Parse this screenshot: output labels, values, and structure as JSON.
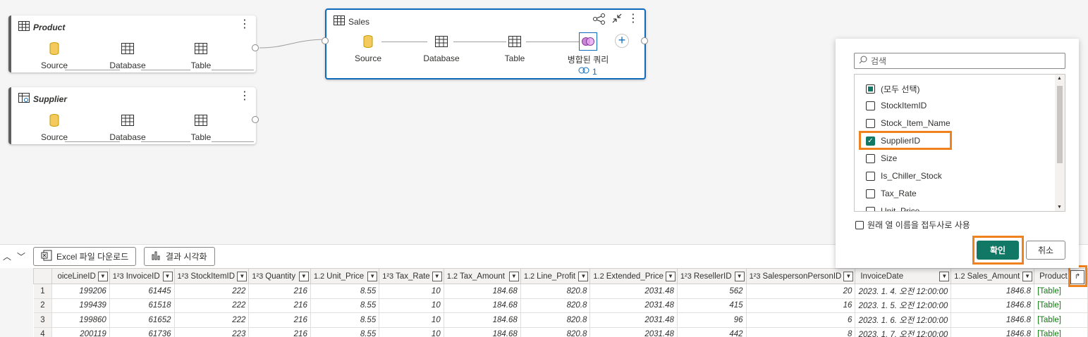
{
  "queries": {
    "product": {
      "title": "Product",
      "steps": [
        "Source",
        "Database",
        "Table"
      ]
    },
    "supplier": {
      "title": "Supplier",
      "steps": [
        "Source",
        "Database",
        "Table"
      ]
    },
    "sales": {
      "title": "Sales",
      "steps": [
        "Source",
        "Database",
        "Table",
        "병합된 쿼리"
      ],
      "link_count": "1"
    }
  },
  "toolbar": {
    "excel_label": "Excel 파일 다운로드",
    "visualize_label": "결과 시각화"
  },
  "filter_panel": {
    "search_placeholder": "검색",
    "items": [
      {
        "label": "(모두 선택)",
        "state": "indeterminate"
      },
      {
        "label": "StockItemID",
        "state": "unchecked"
      },
      {
        "label": "Stock_Item_Name",
        "state": "unchecked"
      },
      {
        "label": "SupplierID",
        "state": "checked"
      },
      {
        "label": "Size",
        "state": "unchecked"
      },
      {
        "label": "Is_Chiller_Stock",
        "state": "unchecked"
      },
      {
        "label": "Tax_Rate",
        "state": "unchecked"
      },
      {
        "label": "Unit_Price",
        "state": "unchecked"
      }
    ],
    "prefix_label": "원래 열 이름을 접두사로 사용",
    "ok_label": "확인",
    "cancel_label": "취소"
  },
  "grid": {
    "columns": [
      {
        "type": "",
        "name": "oiceLineID"
      },
      {
        "type": "1²3",
        "name": "InvoiceID"
      },
      {
        "type": "1²3",
        "name": "StockItemID"
      },
      {
        "type": "1²3",
        "name": "Quantity"
      },
      {
        "type": "1.2",
        "name": "Unit_Price"
      },
      {
        "type": "1²3",
        "name": "Tax_Rate"
      },
      {
        "type": "1.2",
        "name": "Tax_Amount"
      },
      {
        "type": "1.2",
        "name": "Line_Profit"
      },
      {
        "type": "1.2",
        "name": "Extended_Price"
      },
      {
        "type": "1²3",
        "name": "ResellerID"
      },
      {
        "type": "1²3",
        "name": "SalespersonPersonID"
      },
      {
        "type": "",
        "name": "InvoiceDate"
      },
      {
        "type": "1.2",
        "name": "Sales_Amount"
      },
      {
        "type": "",
        "name": "Product"
      }
    ],
    "rows": [
      [
        "1",
        "199206",
        "61445",
        "222",
        "216",
        "8.55",
        "10",
        "184.68",
        "820.8",
        "2031.48",
        "562",
        "20",
        "2023. 1. 4. 오전 12:00:00",
        "1846.8",
        "[Table]"
      ],
      [
        "2",
        "199439",
        "61518",
        "222",
        "216",
        "8.55",
        "10",
        "184.68",
        "820.8",
        "2031.48",
        "415",
        "16",
        "2023. 1. 5. 오전 12:00:00",
        "1846.8",
        "[Table]"
      ],
      [
        "3",
        "199860",
        "61652",
        "222",
        "216",
        "8.55",
        "10",
        "184.68",
        "820.8",
        "2031.48",
        "96",
        "6",
        "2023. 1. 6. 오전 12:00:00",
        "1846.8",
        "[Table]"
      ],
      [
        "4",
        "200119",
        "61736",
        "223",
        "216",
        "8.55",
        "10",
        "184.68",
        "820.8",
        "2031.48",
        "442",
        "8",
        "2023. 1. 7. 오전 12:00:00",
        "1846.8",
        "[Table]"
      ]
    ]
  }
}
